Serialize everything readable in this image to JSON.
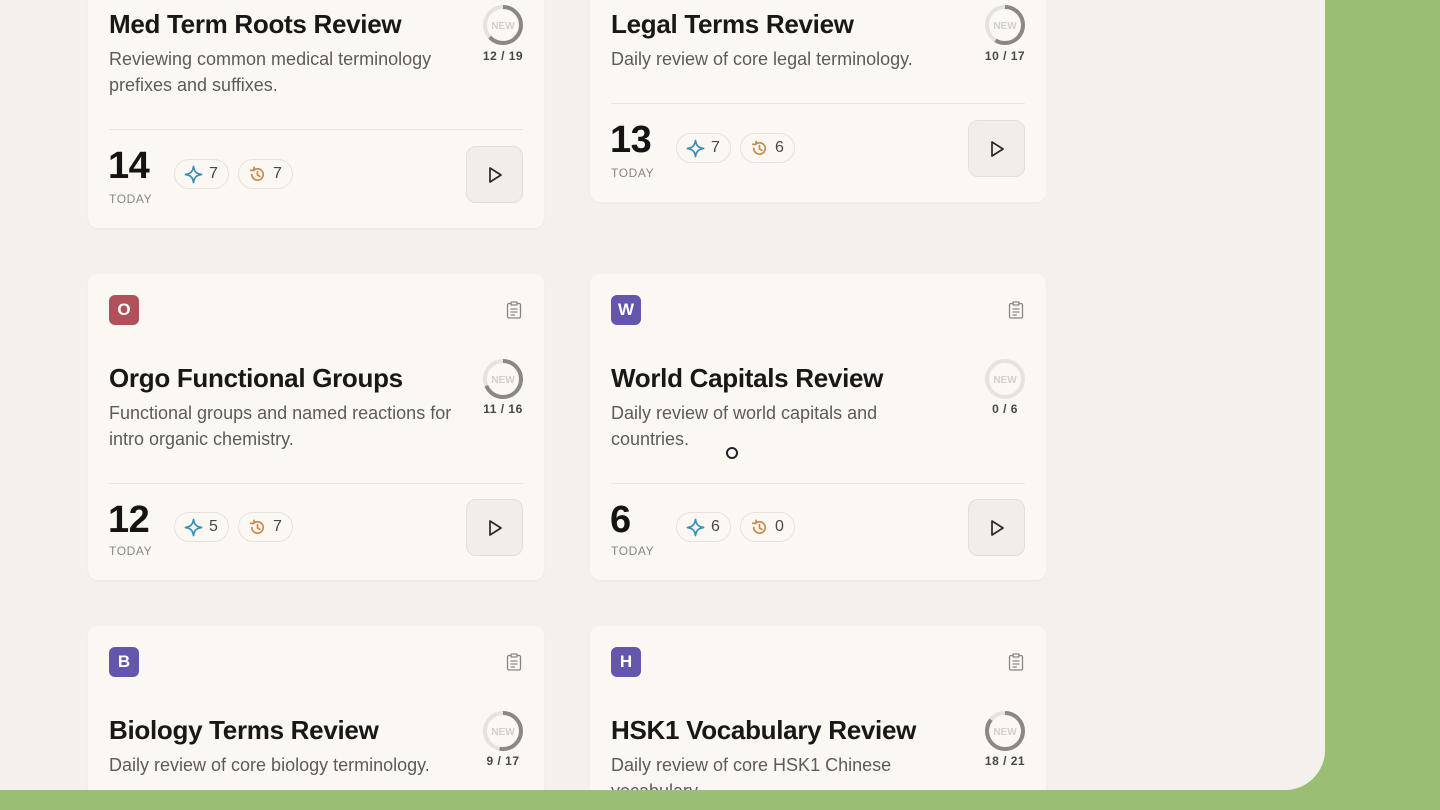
{
  "cards": [
    {
      "badge": "",
      "title": "Med Term Roots Review",
      "desc_line1": "Reviewing common medical terminology",
      "desc_line2": "prefixes and suffixes.",
      "progress": "12 / 19",
      "ring_label": "NEW",
      "today_count": "14",
      "today_label": "TODAY",
      "new_count": "7",
      "review_count": "7"
    },
    {
      "badge": "",
      "title": "Legal Terms Review",
      "desc_line1": "Daily review of core legal terminology.",
      "desc_line2": "",
      "progress": "10 / 17",
      "ring_label": "NEW",
      "today_count": "13",
      "today_label": "TODAY",
      "new_count": "7",
      "review_count": "6"
    },
    {
      "badge": "O",
      "title": "Orgo Functional Groups",
      "desc_line1": "Functional groups and named reactions for",
      "desc_line2": "intro organic chemistry.",
      "progress": "11 / 16",
      "ring_label": "NEW",
      "today_count": "12",
      "today_label": "TODAY",
      "new_count": "5",
      "review_count": "7"
    },
    {
      "badge": "W",
      "title": "World Capitals Review",
      "desc_line1": "Daily review of world capitals and",
      "desc_line2": "countries.",
      "progress": "0 / 6",
      "ring_label": "NEW",
      "today_count": "6",
      "today_label": "TODAY",
      "new_count": "6",
      "review_count": "0"
    },
    {
      "badge": "B",
      "title": "Biology Terms Review",
      "desc_line1": "Daily review of core biology terminology.",
      "desc_line2": "",
      "progress": "9 / 17",
      "ring_label": "NEW"
    },
    {
      "badge": "H",
      "title": "HSK1 Vocabulary Review",
      "desc_line1": "Daily review of core HSK1 Chinese",
      "desc_line2": "vocabulary.",
      "progress": "18 / 21",
      "ring_label": "NEW"
    }
  ],
  "colors": {
    "badge_red": "#b0505a",
    "badge_purple": "#6456ad",
    "accent_teal": "#3a8fb7",
    "accent_orange": "#c98a4b",
    "ring_track": "#e6e2dd",
    "ring_fill": "#8c8782"
  }
}
